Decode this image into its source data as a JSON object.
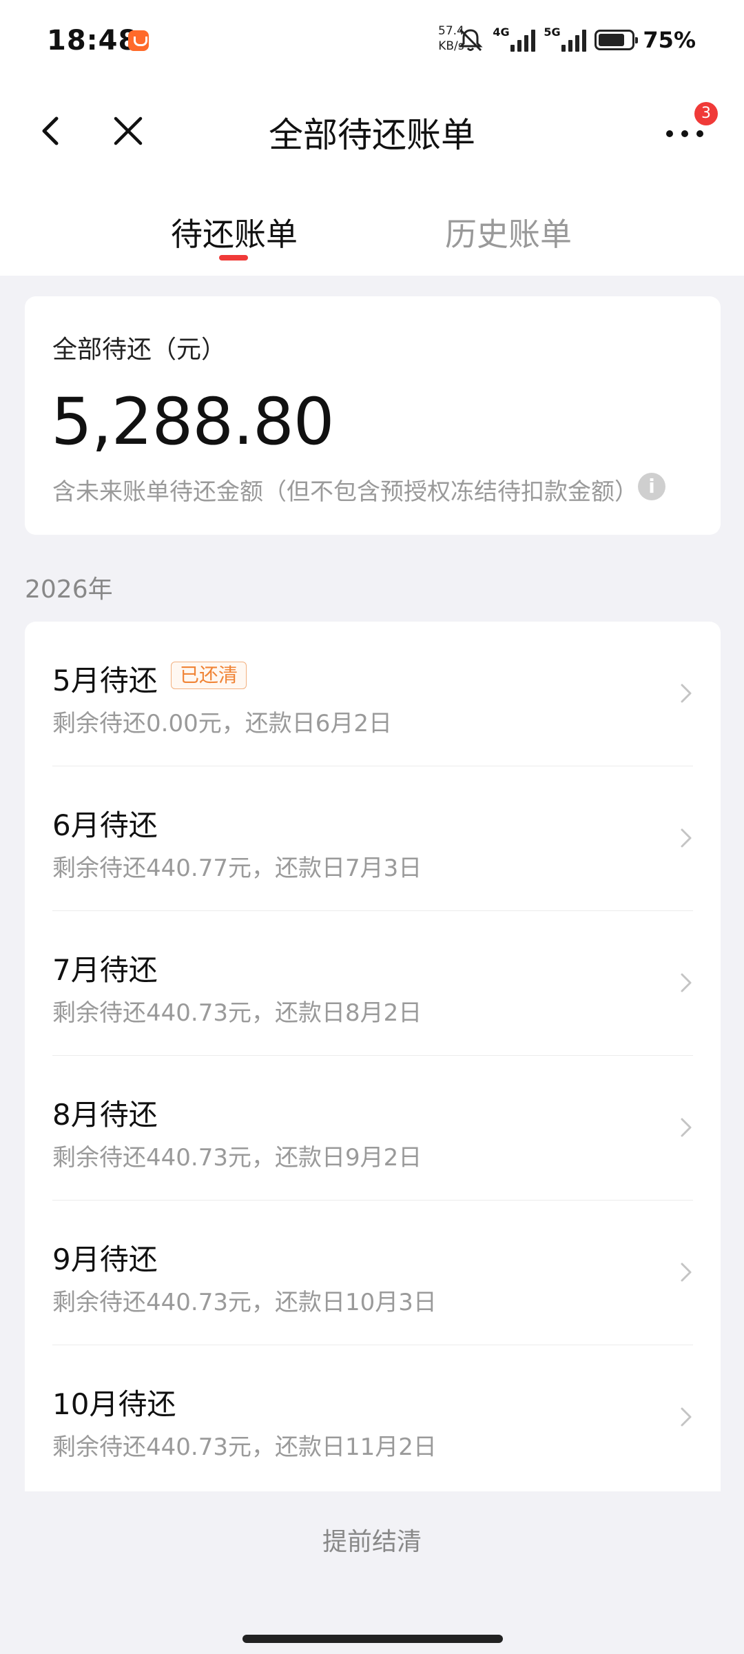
{
  "status_bar": {
    "time": "18:48",
    "speed_value": "57.4",
    "speed_unit": "KB/s",
    "network_1": "4G",
    "network_2": "5G",
    "battery_percent": "75%"
  },
  "nav": {
    "title": "全部待还账单",
    "more_badge": "3"
  },
  "tabs": [
    {
      "label": "待还账单",
      "active": true
    },
    {
      "label": "历史账单",
      "active": false
    }
  ],
  "summary": {
    "label": "全部待还（元）",
    "amount": "5,288.80",
    "note": "含未来账单待还金额（但不包含预授权冻结待扣款金额）"
  },
  "year_header": "2026年",
  "bills": [
    {
      "title": "5月待还",
      "badge": "已还清",
      "subtitle": "剩余待还0.00元，还款日6月2日"
    },
    {
      "title": "6月待还",
      "subtitle": "剩余待还440.77元，还款日7月3日"
    },
    {
      "title": "7月待还",
      "subtitle": "剩余待还440.73元，还款日8月2日"
    },
    {
      "title": "8月待还",
      "subtitle": "剩余待还440.73元，还款日9月2日"
    },
    {
      "title": "9月待还",
      "subtitle": "剩余待还440.73元，还款日10月3日"
    },
    {
      "title": "10月待还",
      "subtitle": "剩余待还440.73元，还款日11月2日"
    }
  ],
  "settle_label": "提前结清",
  "colors": {
    "accent_red": "#f03a38",
    "badge_orange": "#f08436",
    "background": "#f2f2f6"
  }
}
